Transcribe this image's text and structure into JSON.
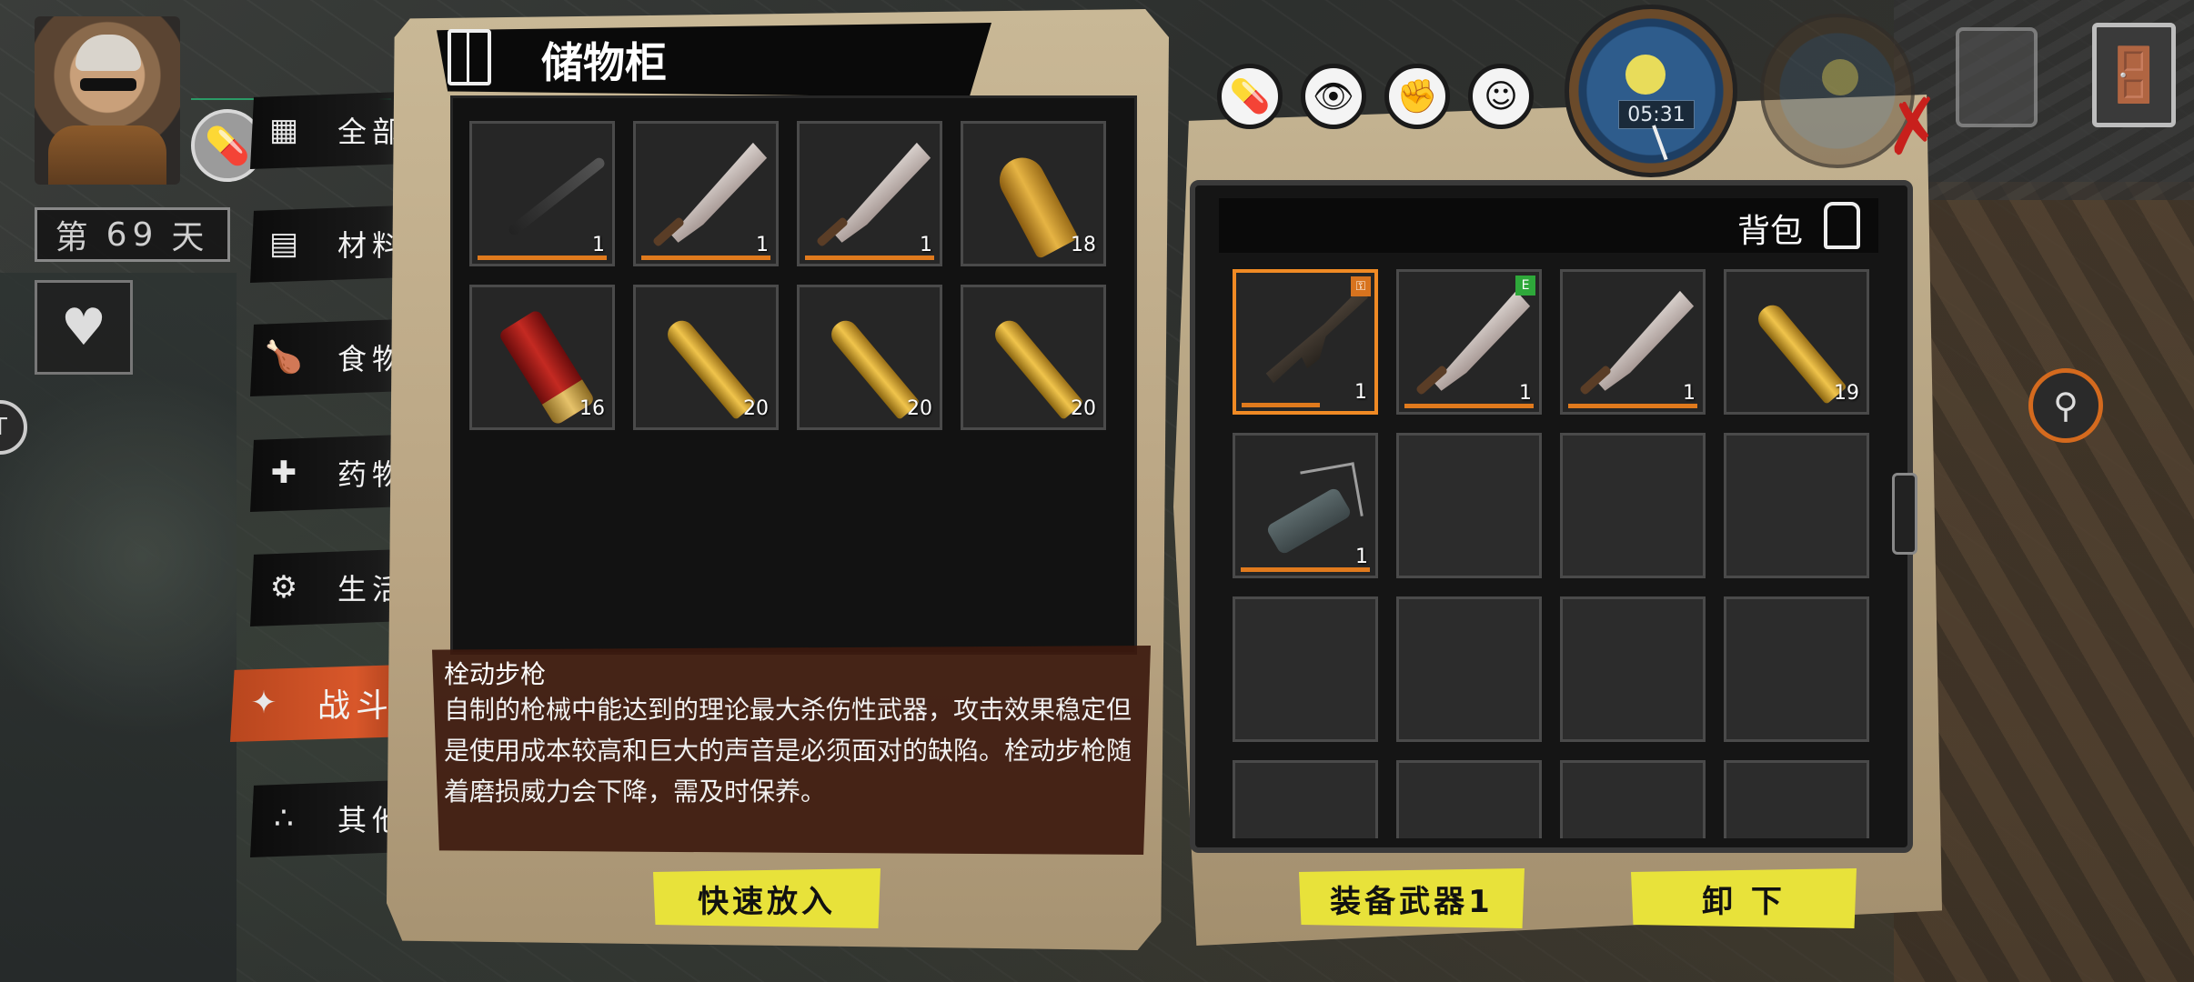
{
  "character": {
    "day_prefix": "第",
    "day_number": "69",
    "day_suffix": "天"
  },
  "tabs": [
    {
      "label": "全部",
      "icon": "grid-icon",
      "glyph": "▦"
    },
    {
      "label": "材料",
      "icon": "materials-icon",
      "glyph": "▤"
    },
    {
      "label": "食物",
      "icon": "food-icon",
      "glyph": "🍗"
    },
    {
      "label": "药物",
      "icon": "medicine-icon",
      "glyph": "✚"
    },
    {
      "label": "生活",
      "icon": "life-icon",
      "glyph": "⚙"
    },
    {
      "label": "战斗",
      "icon": "pistol-icon",
      "glyph": "✦",
      "active": true
    },
    {
      "label": "其他",
      "icon": "other-icon",
      "glyph": "∴"
    }
  ],
  "storage": {
    "title": "储物柜",
    "items": [
      {
        "name": "baseball-bat",
        "count": "1",
        "durability": true
      },
      {
        "name": "machete",
        "count": "1",
        "durability": true
      },
      {
        "name": "machete",
        "count": "1",
        "durability": true
      },
      {
        "name": "pistol-bullet",
        "count": "18",
        "durability": false
      },
      {
        "name": "shotgun-shell",
        "count": "16",
        "durability": false
      },
      {
        "name": "rifle-round",
        "count": "20",
        "durability": false
      },
      {
        "name": "rifle-round",
        "count": "20",
        "durability": false
      },
      {
        "name": "rifle-round",
        "count": "20",
        "durability": false
      }
    ]
  },
  "description": {
    "title": "栓动步枪",
    "text": "自制的枪械中能达到的理论最大杀伤性武器，攻击效果稳定但是使用成本较高和巨大的声音是必须面对的缺陷。栓动步枪随着磨损威力会下降，需及时保养。"
  },
  "buttons": {
    "quick_store": "快速放入",
    "equip_weapon": "装备武器1",
    "unequip": "卸 下"
  },
  "backpack": {
    "title": "背包",
    "items": [
      {
        "name": "bolt-action-rifle",
        "count": "1",
        "durability": true,
        "selected": true,
        "badge": "⚿",
        "badge_color": "#d8731e"
      },
      {
        "name": "machete",
        "count": "1",
        "durability": true,
        "badge": "E",
        "badge_color": "#2ea83a"
      },
      {
        "name": "machete",
        "count": "1",
        "durability": true
      },
      {
        "name": "rifle-round",
        "count": "19",
        "durability": false
      },
      {
        "name": "lockpick",
        "count": "1",
        "durability": true
      }
    ],
    "empty_slots": 11
  },
  "hud": {
    "clock_time": "05:31",
    "status_icons": [
      {
        "name": "pill-status-icon",
        "glyph": "💊"
      },
      {
        "name": "eye-status-icon",
        "glyph": "👁"
      },
      {
        "name": "fist-status-icon",
        "glyph": "✊"
      },
      {
        "name": "mood-status-icon",
        "glyph": "☺"
      }
    ],
    "close_glyph": "✗",
    "exit_glyph": "🚪"
  }
}
